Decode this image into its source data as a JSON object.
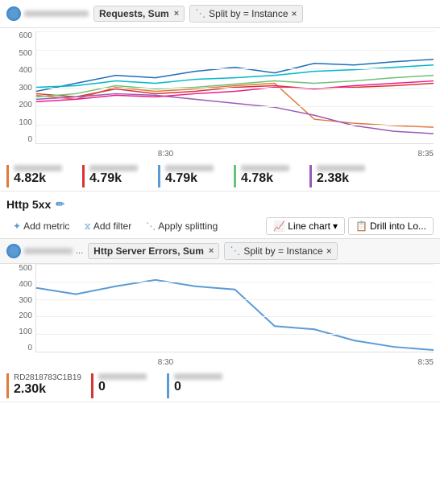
{
  "toolbar1": {
    "requests_label": "Requests, Sum",
    "close_label": "×",
    "split_label": "Split by = Instance",
    "split_close": "×"
  },
  "chart1": {
    "yaxis": [
      "600",
      "500",
      "400",
      "300",
      "200",
      "100",
      "0"
    ],
    "xaxis_left": "",
    "xaxis_mid": "8:30",
    "xaxis_right": "8:35"
  },
  "legend1": {
    "cards": [
      {
        "id": "c1",
        "color": "#e07b39",
        "label": "RD",
        "value": "4.82k"
      },
      {
        "id": "c2",
        "color": "#d83434",
        "label": "RD",
        "value": "4.79k"
      },
      {
        "id": "c3",
        "color": "#5b9bd5",
        "label": "RD",
        "value": "4.79k"
      },
      {
        "id": "c4",
        "color": "#6dc175",
        "label": "RD",
        "value": "4.78k"
      },
      {
        "id": "c5",
        "color": "#9b59b6",
        "label": "RD",
        "value": "2.38k"
      }
    ]
  },
  "section2": {
    "title": "Http 5xx",
    "edit_tooltip": "Edit"
  },
  "metric_toolbar": {
    "add_metric": "Add metric",
    "add_filter": "Add filter",
    "apply_splitting": "Apply splitting",
    "line_chart": "Line chart",
    "drill_into": "Drill into Lo..."
  },
  "toolbar2": {
    "server_errors_label": "Http Server Errors, Sum",
    "close_label": "×",
    "split_label": "Split by = Instance",
    "split_close": "×"
  },
  "chart2": {
    "yaxis": [
      "500",
      "400",
      "300",
      "200",
      "100",
      "0"
    ],
    "xaxis_mid": "8:30",
    "xaxis_right": "8:35"
  },
  "legend2": {
    "cards": [
      {
        "id": "d1",
        "color": "#e07b39",
        "label": "RD2818783C1B19",
        "value": "2.30k"
      },
      {
        "id": "d2",
        "color": "#d83434",
        "label": "RD",
        "value": "0"
      },
      {
        "id": "d3",
        "color": "#5b9bd5",
        "label": "RD",
        "value": "0"
      }
    ]
  },
  "colors": {
    "accent": "#5b9bd5"
  }
}
